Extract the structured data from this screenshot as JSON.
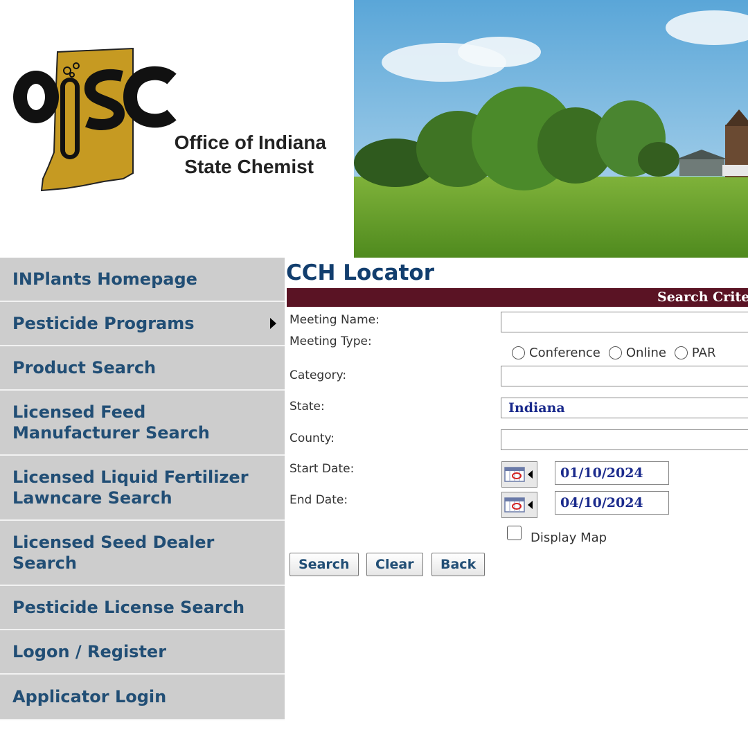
{
  "header": {
    "logo_letters": "OISC",
    "org_line1": "Office of Indiana",
    "org_line2": "State Chemist",
    "banner_icon": "farm-landscape-image"
  },
  "sidebar": {
    "items": [
      {
        "label": "INPlants Homepage"
      },
      {
        "label": "Pesticide Programs",
        "submenu_icon": "triangle-right-icon"
      },
      {
        "label": "Product Search"
      },
      {
        "label": "Licensed Feed Manufacturer Search"
      },
      {
        "label": "Licensed Liquid Fertilizer Lawncare Search"
      },
      {
        "label": "Licensed Seed Dealer Search"
      },
      {
        "label": "Pesticide License Search"
      },
      {
        "label": "Logon / Register"
      },
      {
        "label": "Applicator Login"
      }
    ]
  },
  "main": {
    "title": "CCH Locator",
    "criteria_label": "Search Crite",
    "fields": {
      "meeting_name_label": "Meeting Name:",
      "meeting_name_value": "",
      "meeting_type_label": "Meeting Type:",
      "meeting_type_options": [
        "Conference",
        "Online",
        "PAR"
      ],
      "category_label": "Category:",
      "category_value": "",
      "state_label": "State:",
      "state_value": "Indiana",
      "county_label": "County:",
      "county_value": "",
      "start_date_label": "Start Date:",
      "start_date_value": "01/10/2024",
      "end_date_label": "End Date:",
      "end_date_value": "04/10/2024",
      "display_map_label": "Display Map"
    },
    "buttons": {
      "search": "Search",
      "clear": "Clear",
      "back": "Back"
    }
  },
  "colors": {
    "nav_bg": "#cdcdcd",
    "nav_text": "#214e75",
    "title": "#123e6e",
    "criteria_bar": "#5a1324",
    "value_text": "#1a2a8c",
    "logo_gold": "#c69a22"
  }
}
